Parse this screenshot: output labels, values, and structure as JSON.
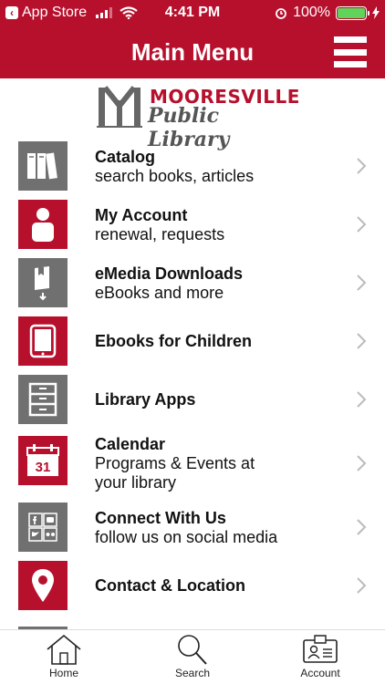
{
  "status": {
    "back_label": "App Store",
    "time": "4:41 PM",
    "battery": "100%",
    "battery_color": "#5fd35a"
  },
  "header": {
    "title": "Main Menu"
  },
  "logo": {
    "line1": "MOORESVILLE",
    "line2": "Public Library"
  },
  "menu": {
    "items": [
      {
        "title": "Catalog",
        "subtitle": "search books, articles",
        "icon": "books-icon"
      },
      {
        "title": "My Account",
        "subtitle": "renewal, requests",
        "icon": "person-icon"
      },
      {
        "title": "eMedia Downloads",
        "subtitle": "eBooks and more",
        "icon": "download-book-icon"
      },
      {
        "title": "Ebooks for Children",
        "subtitle": "",
        "icon": "tablet-icon"
      },
      {
        "title": "Library Apps",
        "subtitle": "",
        "icon": "cabinet-icon"
      },
      {
        "title": "Calendar",
        "subtitle": "Programs & Events at your library",
        "icon": "calendar-icon",
        "calendar_day": "31"
      },
      {
        "title": "Connect With Us",
        "subtitle": "follow us on social media",
        "icon": "social-icon"
      },
      {
        "title": "Contact & Location",
        "subtitle": "",
        "icon": "map-pin-icon"
      }
    ]
  },
  "tabs": [
    {
      "label": "Home",
      "icon": "home-icon"
    },
    {
      "label": "Search",
      "icon": "search-icon"
    },
    {
      "label": "Account",
      "icon": "id-card-icon"
    }
  ],
  "colors": {
    "brand_red": "#b7102d",
    "icon_gray": "#707070"
  }
}
